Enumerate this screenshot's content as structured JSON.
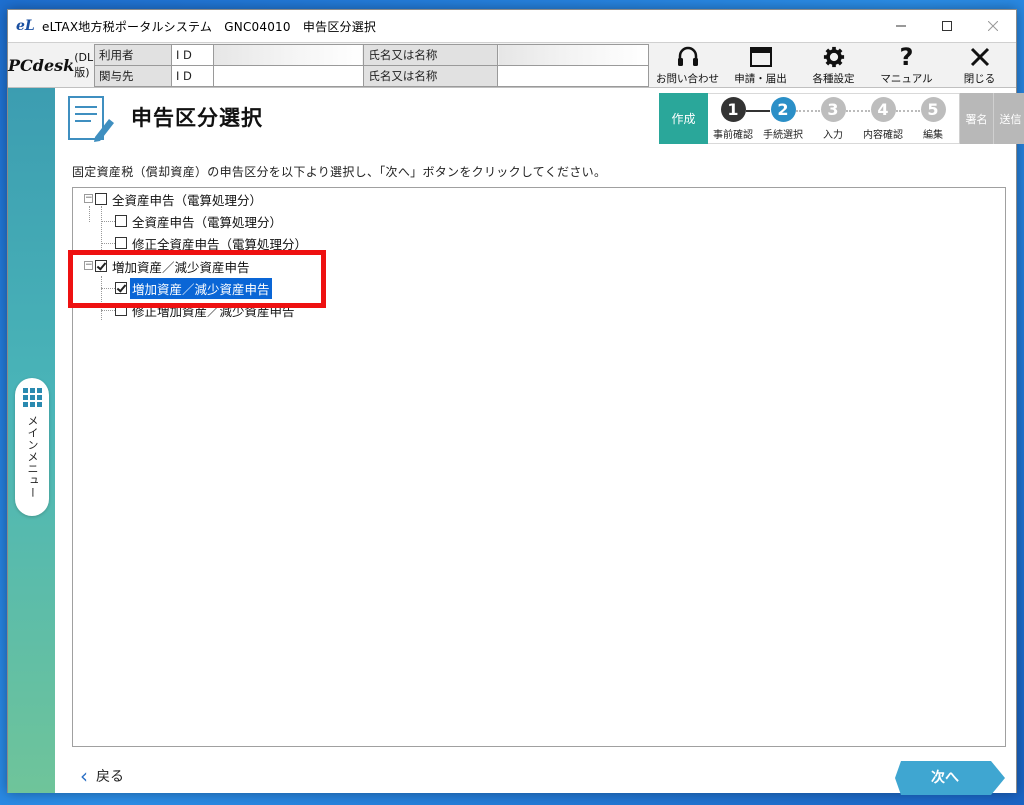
{
  "window": {
    "title": "eLTAX地方税ポータルシステム　GNC04010　申告区分選択",
    "logo_text": "eL"
  },
  "brand": {
    "main": "PCdesk",
    "sub": "(DL版)"
  },
  "user_info": {
    "row1_label": "利用者",
    "row2_label": "関与先",
    "id_label": "I D",
    "name_label": "氏名又は名称"
  },
  "toolbar": [
    {
      "label": "お問い合わせ",
      "icon": "headset-icon"
    },
    {
      "label": "申請・届出",
      "icon": "window-icon"
    },
    {
      "label": "各種設定",
      "icon": "gear-icon"
    },
    {
      "label": "マニュアル",
      "icon": "question-icon"
    },
    {
      "label": "閉じる",
      "icon": "close-icon"
    }
  ],
  "side_menu": {
    "label": "メインメニュー"
  },
  "page": {
    "title": "申告区分選択",
    "instruction": "固定資産税（償却資産）の申告区分を以下より選択し、「次へ」ボタンをクリックしてください。"
  },
  "steps": {
    "create": "作成",
    "items": [
      {
        "num": "1",
        "label": "事前確認"
      },
      {
        "num": "2",
        "label": "手続選択"
      },
      {
        "num": "3",
        "label": "入力"
      },
      {
        "num": "4",
        "label": "内容確認"
      },
      {
        "num": "5",
        "label": "編集"
      }
    ],
    "sign": "署名",
    "send": "送信",
    "colors": {
      "done": "#333333",
      "current": "#2b8fc7",
      "todo": "#bdbdbd",
      "create_bg": "#2aa79a"
    }
  },
  "tree": {
    "group1": {
      "label": "全資産申告（電算処理分）",
      "checked": false
    },
    "group1_items": [
      {
        "label": "全資産申告（電算処理分）",
        "checked": false
      },
      {
        "label": "修正全資産申告（電算処理分）",
        "checked": false
      }
    ],
    "group2": {
      "label": "増加資産／減少資産申告",
      "checked": true
    },
    "group2_items": [
      {
        "label": "増加資産／減少資産申告",
        "checked": true,
        "selected": true
      },
      {
        "label": "修正増加資産／減少資産申告",
        "checked": false
      }
    ]
  },
  "nav": {
    "back": "戻る",
    "next": "次へ"
  },
  "highlight_color": "#e11111"
}
